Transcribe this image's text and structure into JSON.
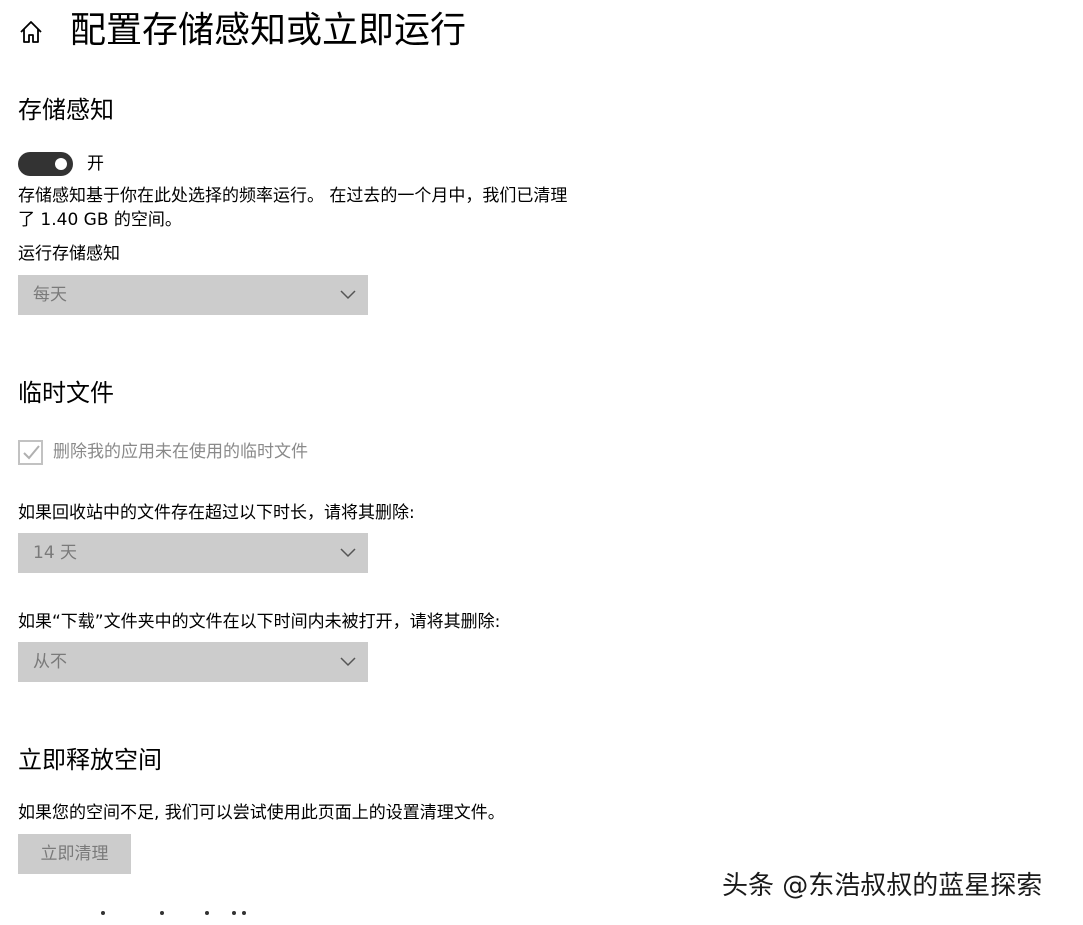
{
  "header": {
    "title": "配置存储感知或立即运行",
    "home_icon": "home-icon"
  },
  "storage_sense": {
    "heading": "存储感知",
    "toggle_state": "开",
    "toggle_on": true,
    "description": "存储感知基于你在此处选择的频率运行。 在过去的一个月中，我们已清理了 1.40 GB 的空间。",
    "run_label": "运行存储感知",
    "run_value": "每天"
  },
  "temp_files": {
    "heading": "临时文件",
    "checkbox_label": "删除我的应用未在使用的临时文件",
    "checkbox_checked": true,
    "recycle_label": "如果回收站中的文件存在超过以下时长，请将其删除:",
    "recycle_value": "14 天",
    "downloads_label": "如果“下载”文件夹中的文件在以下时间内未被打开，请将其删除:",
    "downloads_value": "从不"
  },
  "free_space": {
    "heading": "立即释放空间",
    "description": "如果您的空间不足, 我们可以尝试使用此页面上的设置清理文件。",
    "button_label": "立即清理"
  },
  "watermark": {
    "text": "头条 @东浩叔叔的蓝星探索"
  },
  "colors": {
    "toggle_on": "#333333",
    "dropdown_bg": "#cccccc",
    "disabled_text": "#7a7a7a"
  }
}
